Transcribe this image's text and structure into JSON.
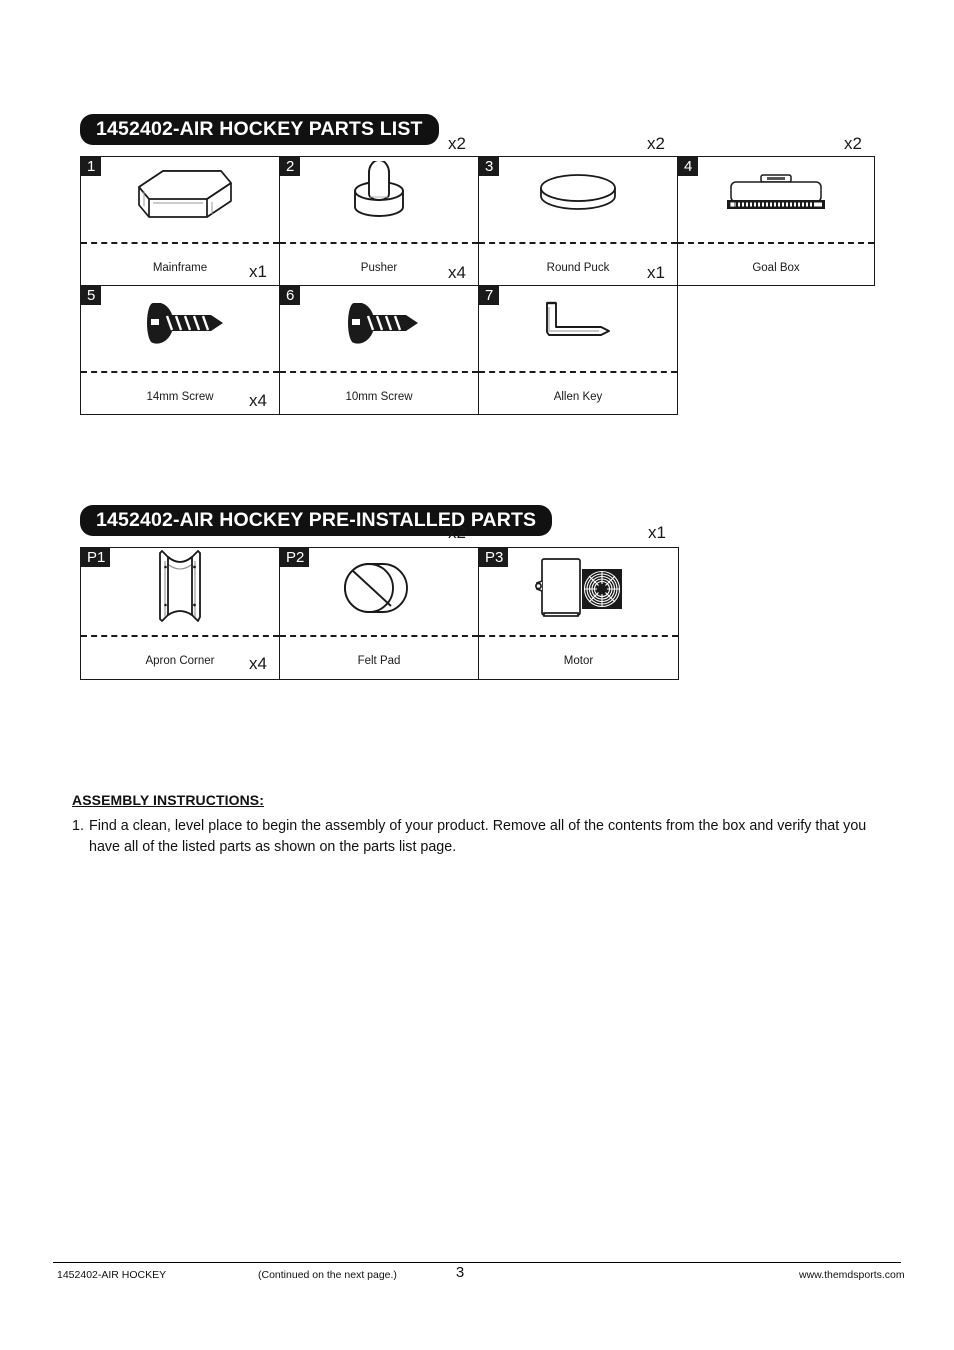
{
  "document": {
    "page_number": "3",
    "footer_left": "1452402-AIR HOCKEY",
    "footer_center_note": "(Continued on the next page.)",
    "footer_right": "www.themdsports.com"
  },
  "parts_list": {
    "banner_title": "1452402-AIR HOCKEY PARTS LIST",
    "items": [
      {
        "index": "1",
        "name": "Mainframe",
        "qty": "x1",
        "icon": "mainframe-icon"
      },
      {
        "index": "2",
        "name": "Pusher",
        "qty": "x2",
        "icon": "pusher-icon"
      },
      {
        "index": "3",
        "name": "Round Puck",
        "qty": "x2",
        "icon": "round-puck-icon"
      },
      {
        "index": "4",
        "name": "Goal Box",
        "qty": "x2",
        "icon": "goal-box-icon"
      },
      {
        "index": "5",
        "name": "14mm Screw",
        "qty": "x4",
        "icon": "screw-icon"
      },
      {
        "index": "6",
        "name": "10mm Screw",
        "qty": "x4",
        "icon": "screw-icon"
      },
      {
        "index": "7",
        "name": "Allen Key",
        "qty": "x1",
        "icon": "allen-key-icon"
      }
    ]
  },
  "pre_installed_parts": {
    "banner_title": "1452402-AIR HOCKEY PRE-INSTALLED PARTS",
    "items": [
      {
        "index": "P1",
        "name": "Apron Corner",
        "qty": "x4",
        "icon": "apron-corner-icon"
      },
      {
        "index": "P2",
        "name": "Felt Pad",
        "qty": "x2",
        "icon": "felt-pad-icon"
      },
      {
        "index": "P3",
        "name": "Motor",
        "qty": "x1",
        "icon": "motor-icon"
      }
    ]
  },
  "assembly": {
    "heading": "ASSEMBLY INSTRUCTIONS:",
    "steps": [
      {
        "number": "1.",
        "text": "Find a clean, level place to begin the assembly of your product. Remove all of the contents from the box and verify that you have all of the listed parts as shown on the parts list page."
      }
    ]
  },
  "colors": {
    "ink": "#1a1a1a",
    "banner_bg": "#111111",
    "banner_text": "#ffffff",
    "page_bg": "#ffffff"
  }
}
